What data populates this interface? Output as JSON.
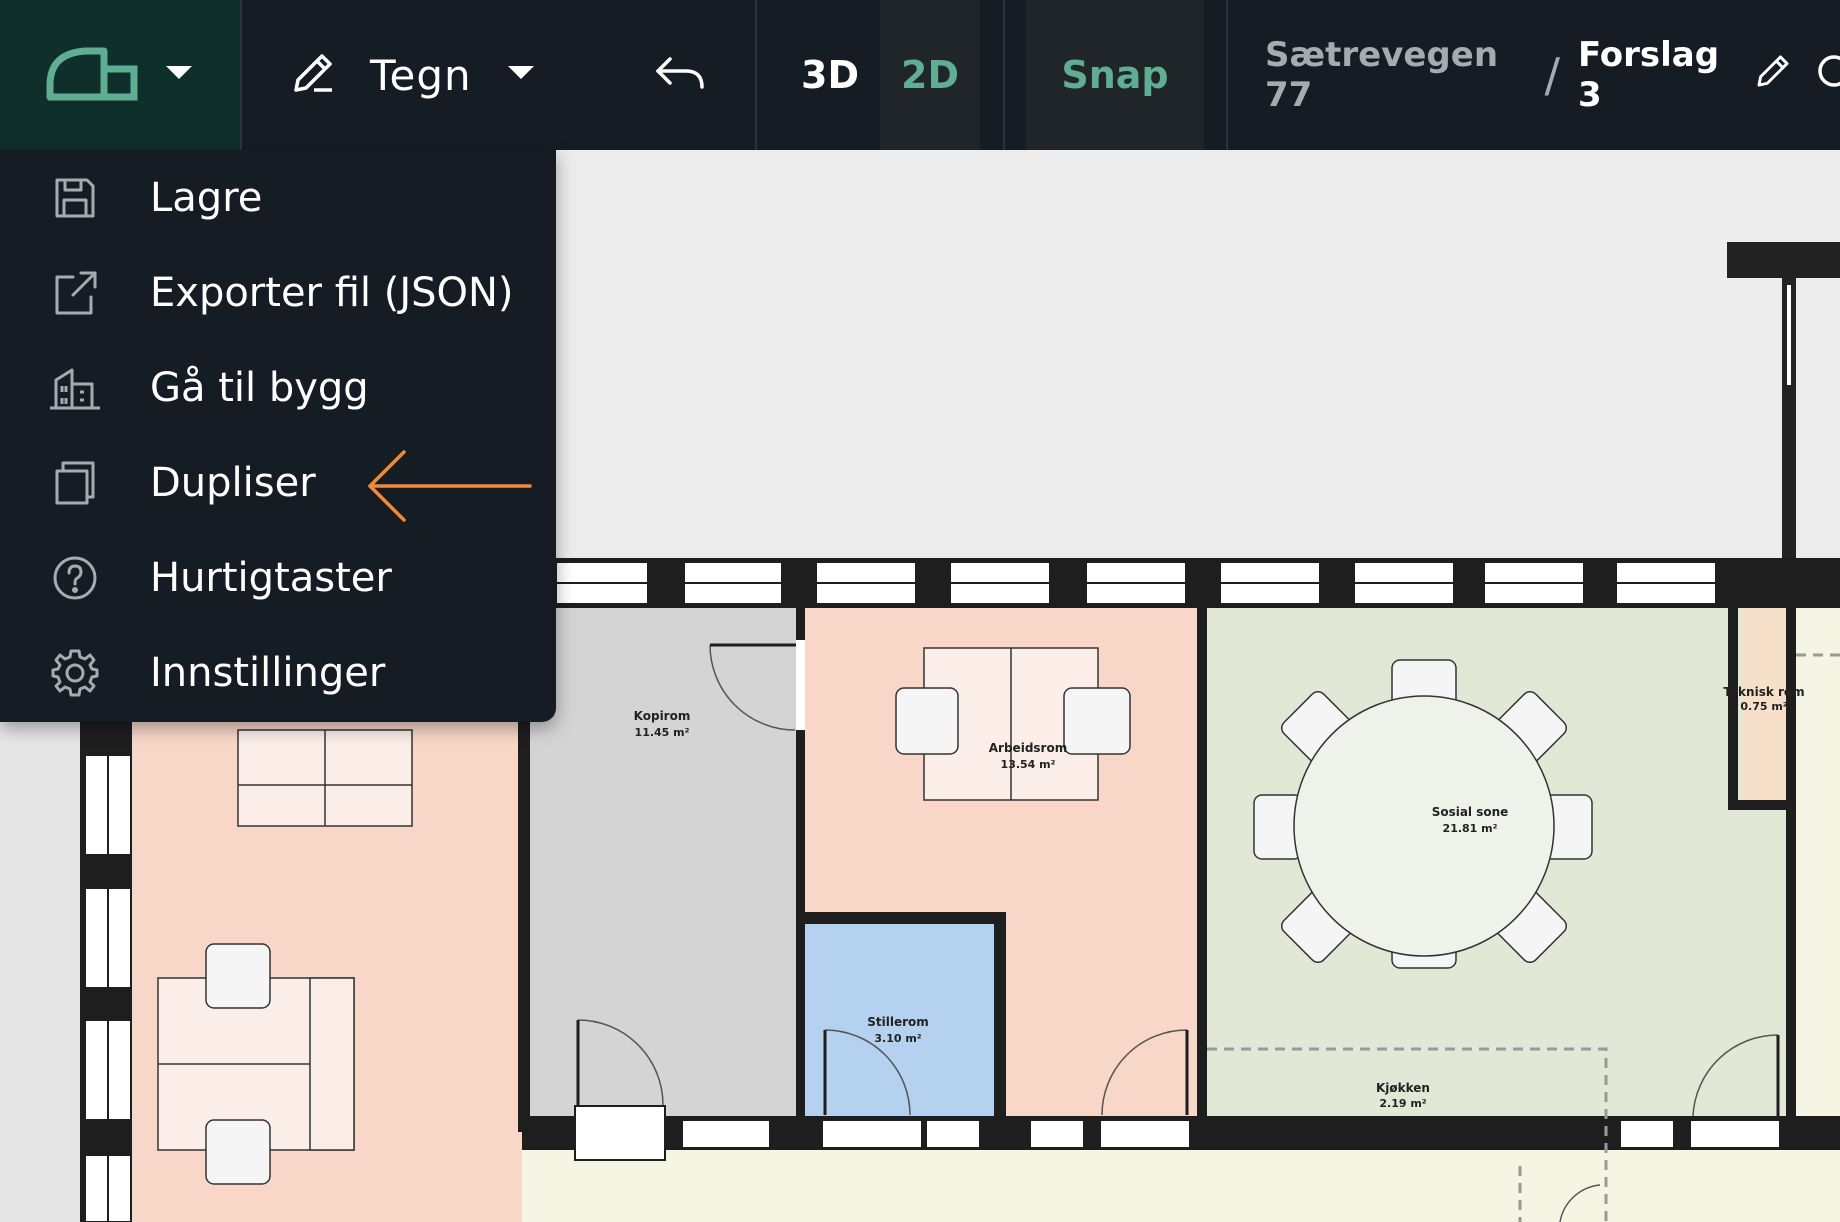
{
  "toolbar": {
    "draw_label": "Tegn",
    "view_3d": "3D",
    "view_2d": "2D",
    "snap": "Snap",
    "breadcrumb": {
      "address": "Sætrevegen 77",
      "separator": "/",
      "proposal": "Forslag 3"
    }
  },
  "menu": {
    "items": [
      {
        "label": "Lagre",
        "icon": "save-icon"
      },
      {
        "label": "Exporter fil (JSON)",
        "icon": "export-icon"
      },
      {
        "label": "Gå til bygg",
        "icon": "building-icon"
      },
      {
        "label": "Dupliser",
        "icon": "duplicate-icon"
      },
      {
        "label": "Hurtigtaster",
        "icon": "help-icon"
      },
      {
        "label": "Innstillinger",
        "icon": "gear-icon"
      }
    ]
  },
  "rooms": [
    {
      "name": "Kopirom",
      "area": "11.45 m²"
    },
    {
      "name": "Arbeidsrom",
      "area": "13.54 m²"
    },
    {
      "name": "Sosial sone",
      "area": "21.81 m²"
    },
    {
      "name": "Teknisk rom",
      "area": "0.75 m²"
    },
    {
      "name": "Stillerom",
      "area": "3.10 m²"
    },
    {
      "name": "Kjøkken",
      "area": "2.19 m²"
    }
  ],
  "colors": {
    "toolbar_bg": "#161c24",
    "accent_green": "#5fae91",
    "annotation_arrow": "#ef8a3c",
    "room_peach": "#f8d7c8",
    "room_grey": "#d4d4d4",
    "room_green": "#e2e8d6",
    "room_blue": "#b4d2ef",
    "corridor_cream": "#f6f4e2"
  }
}
